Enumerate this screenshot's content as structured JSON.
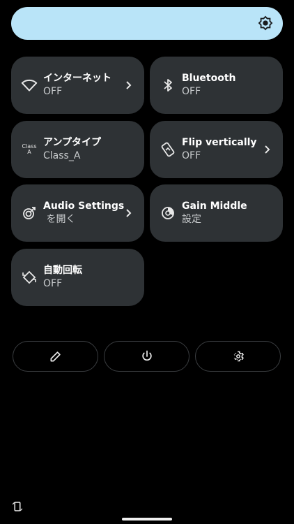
{
  "brightness": {
    "icon": "brightness-icon",
    "color": "#b9e4f8"
  },
  "tiles": [
    {
      "title": "インターネット",
      "subtitle": "OFF",
      "icon": "wifi-icon",
      "has_chevron": true
    },
    {
      "title": "Bluetooth",
      "subtitle": "OFF",
      "icon": "bluetooth-icon",
      "has_chevron": false
    },
    {
      "title": "アンプタイプ",
      "subtitle": "Class_A",
      "icon": "class-a-icon",
      "icon_text": "Class",
      "icon_text2": "A",
      "has_chevron": false
    },
    {
      "title": "Flip vertically",
      "subtitle": "OFF",
      "icon": "flip-icon",
      "has_chevron": true
    },
    {
      "title": "Audio Settings",
      "subtitle": " を開く",
      "icon": "audio-settings-icon",
      "has_chevron": true
    },
    {
      "title": "Gain Middle",
      "subtitle": "設定",
      "icon": "gain-icon",
      "has_chevron": false
    },
    {
      "title": "自動回転",
      "subtitle": "OFF",
      "icon": "auto-rotate-icon",
      "has_chevron": false
    }
  ],
  "bottom_buttons": [
    {
      "icon": "edit-icon"
    },
    {
      "icon": "power-icon"
    },
    {
      "icon": "settings-icon"
    }
  ],
  "colors": {
    "tile_bg": "#2e3235",
    "background": "#000000",
    "subtitle": "#c8cbcd"
  }
}
